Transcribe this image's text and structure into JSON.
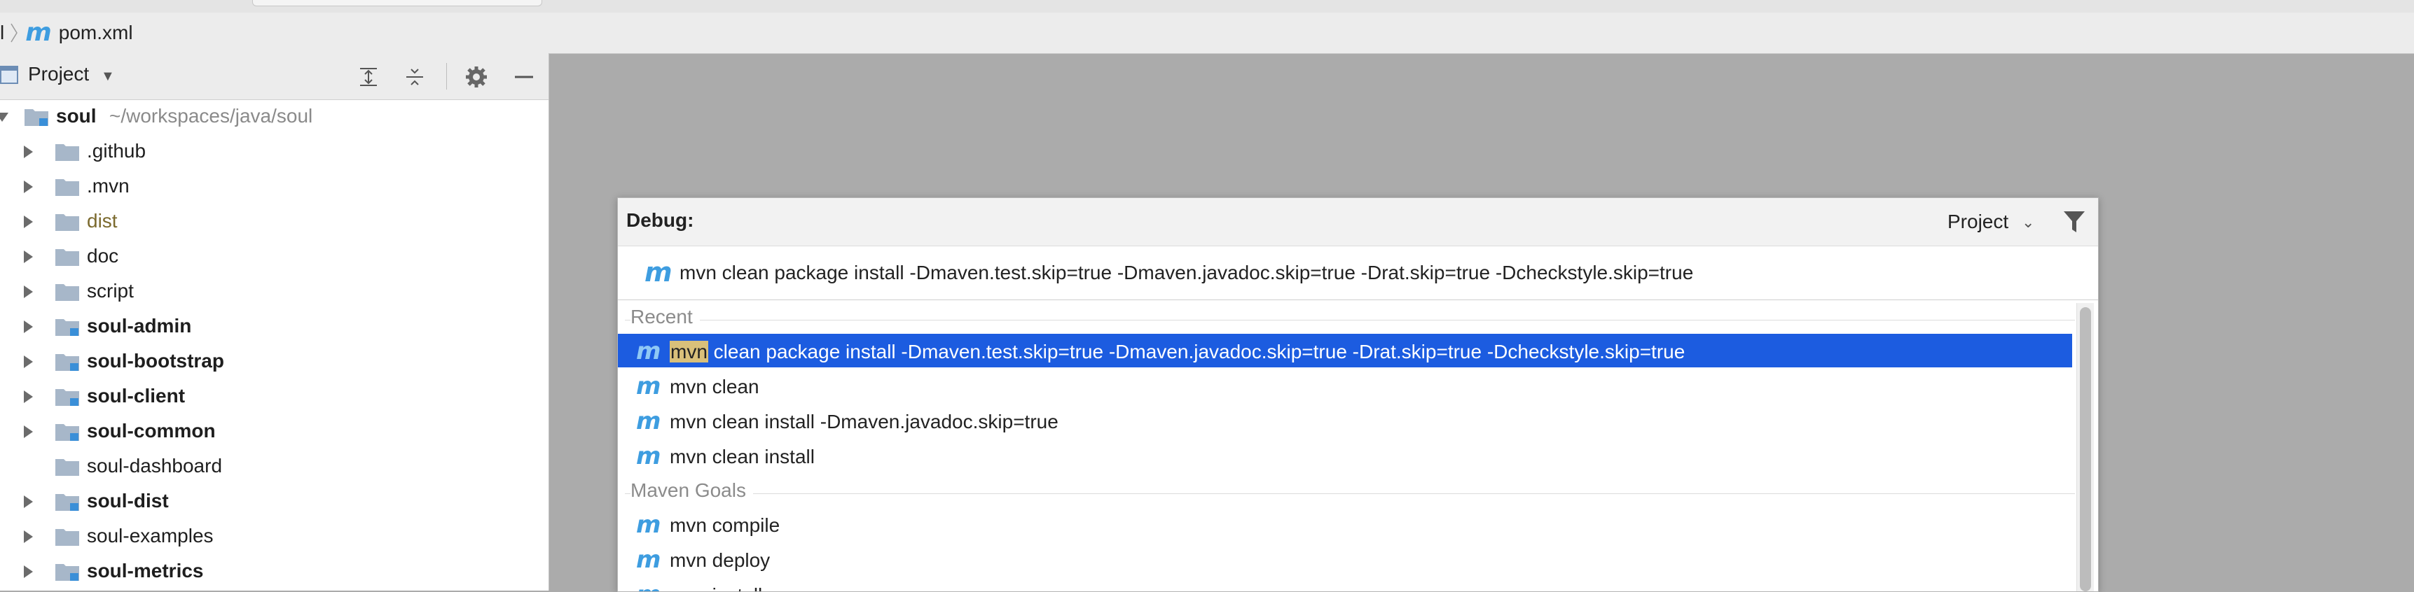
{
  "breadcrumb": {
    "left_fragment": "l",
    "file_icon": "maven-icon",
    "file_name": "pom.xml"
  },
  "project_panel": {
    "title": "Project",
    "toolbar_icons": [
      "expand-all-icon",
      "collapse-all-icon",
      "gear-icon",
      "minimize-icon"
    ],
    "root": {
      "name": "soul",
      "path": "~/workspaces/java/soul"
    },
    "items": [
      {
        "name": ".github",
        "style": "normal",
        "expandable": true
      },
      {
        "name": ".mvn",
        "style": "normal",
        "expandable": true
      },
      {
        "name": "dist",
        "style": "olive",
        "expandable": true
      },
      {
        "name": "doc",
        "style": "normal",
        "expandable": true
      },
      {
        "name": "script",
        "style": "normal",
        "expandable": true
      },
      {
        "name": "soul-admin",
        "style": "bold",
        "expandable": true
      },
      {
        "name": "soul-bootstrap",
        "style": "bold",
        "expandable": true
      },
      {
        "name": "soul-client",
        "style": "bold",
        "expandable": true
      },
      {
        "name": "soul-common",
        "style": "bold",
        "expandable": true
      },
      {
        "name": "soul-dashboard",
        "style": "normal",
        "expandable": false
      },
      {
        "name": "soul-dist",
        "style": "bold",
        "expandable": true
      },
      {
        "name": "soul-examples",
        "style": "normal",
        "expandable": true
      },
      {
        "name": "soul-metrics",
        "style": "bold",
        "expandable": true
      }
    ]
  },
  "popup": {
    "title": "Debug:",
    "scope": "Project",
    "command": "mvn clean package install -Dmaven.test.skip=true -Dmaven.javadoc.skip=true -Drat.skip=true -Dcheckstyle.skip=true",
    "recent_label": "Recent",
    "recent": [
      {
        "prefix": "mvn",
        "rest": " clean package install -Dmaven.test.skip=true -Dmaven.javadoc.skip=true -Drat.skip=true -Dcheckstyle.skip=true",
        "selected": true
      },
      {
        "prefix": "",
        "rest": "mvn clean",
        "selected": false
      },
      {
        "prefix": "",
        "rest": "mvn clean install -Dmaven.javadoc.skip=true",
        "selected": false
      },
      {
        "prefix": "",
        "rest": "mvn clean install",
        "selected": false
      }
    ],
    "goals_label": "Maven Goals",
    "goals": [
      "mvn compile",
      "mvn deploy",
      "mvn install"
    ]
  },
  "colors": {
    "selection": "#1c5ce0",
    "maven_icon": "#3e9de0",
    "match_highlight": "#d9c07a"
  }
}
